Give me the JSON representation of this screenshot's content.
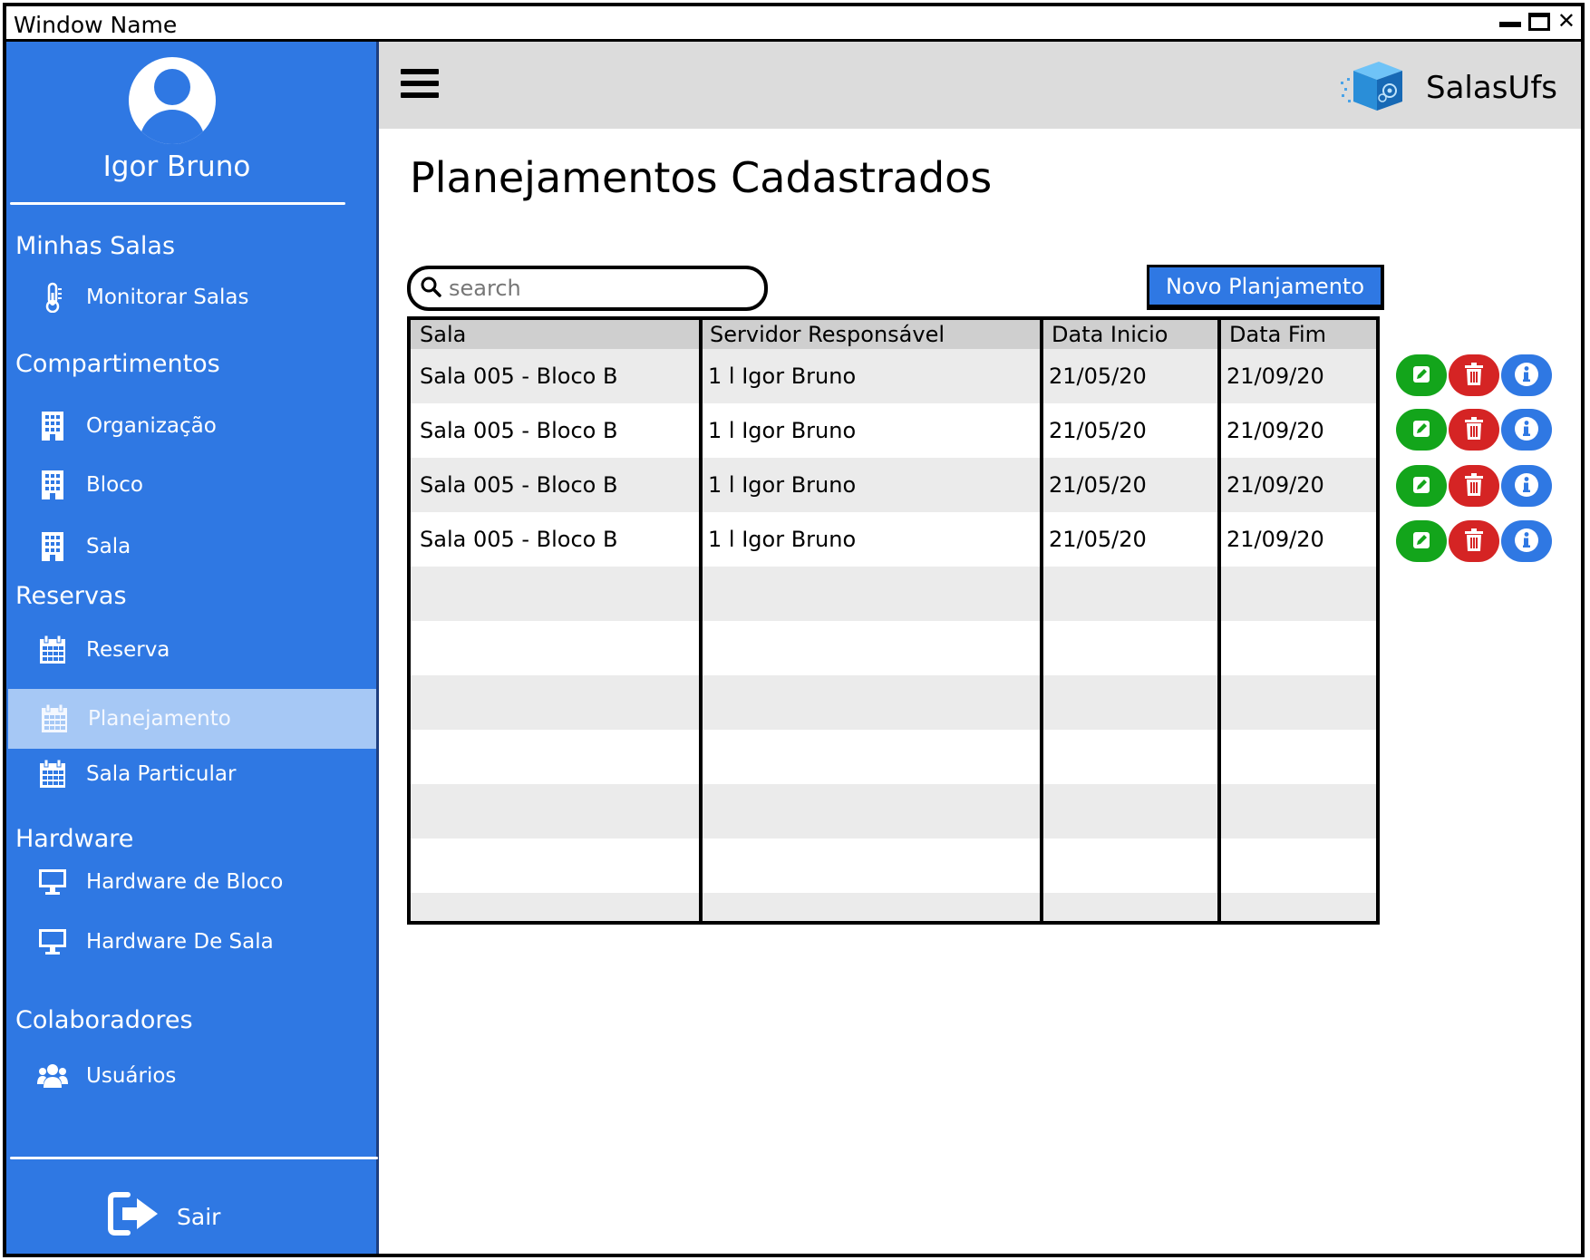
{
  "window": {
    "title": "Window Name"
  },
  "user": {
    "name": "Igor Bruno",
    "avatar_icon": "user-avatar-icon"
  },
  "sidebar": {
    "sections": [
      {
        "label": "Minhas Salas",
        "items": [
          {
            "label": "Monitorar Salas",
            "icon": "thermometer-icon"
          }
        ]
      },
      {
        "label": "Compartimentos",
        "items": [
          {
            "label": "Organização",
            "icon": "building-icon"
          },
          {
            "label": "Bloco",
            "icon": "building-icon"
          },
          {
            "label": "Sala",
            "icon": "building-icon"
          }
        ]
      },
      {
        "label": "Reservas",
        "items": [
          {
            "label": "Reserva",
            "icon": "calendar-icon"
          },
          {
            "label": "Planejamento",
            "icon": "calendar-icon",
            "active": true
          },
          {
            "label": "Sala Particular",
            "icon": "calendar-icon"
          }
        ]
      },
      {
        "label": "Hardware",
        "items": [
          {
            "label": "Hardware de Bloco",
            "icon": "monitor-icon"
          },
          {
            "label": "Hardware De Sala",
            "icon": "monitor-icon"
          }
        ]
      },
      {
        "label": "Colaboradores",
        "items": [
          {
            "label": "Usuários",
            "icon": "users-icon"
          }
        ]
      }
    ],
    "logout_label": "Sair"
  },
  "header": {
    "brand": "SalasUfs",
    "brand_icon": "cube-logo-icon",
    "menu_icon": "hamburger-icon"
  },
  "page": {
    "title": "Planejamentos Cadastrados",
    "search_placeholder": "search",
    "new_button": "Novo Planjamento"
  },
  "table": {
    "columns": [
      "Sala",
      "Servidor Responsável",
      "Data Inicio",
      "Data Fim"
    ],
    "rows": [
      [
        "Sala 005 - Bloco B",
        "1 l Igor Bruno",
        "21/05/20",
        "21/09/20"
      ],
      [
        "Sala 005 - Bloco B",
        "1 l Igor Bruno",
        "21/05/20",
        "21/09/20"
      ],
      [
        "Sala 005 - Bloco B",
        "1 l Igor Bruno",
        "21/05/20",
        "21/09/20"
      ],
      [
        "Sala 005 - Bloco B",
        "1 l Igor Bruno",
        "21/05/20",
        "21/09/20"
      ]
    ],
    "row_actions": [
      "edit-icon",
      "trash-icon",
      "info-icon"
    ]
  },
  "colors": {
    "sidebar": "#2f78e3",
    "active_item": "#a6c8f5",
    "topbar": "#dcdcdc",
    "edit": "#13a51b",
    "delete": "#d52424",
    "info": "#2f78e3",
    "row_alt": "#ebebeb",
    "header_row": "#cfcfcf"
  }
}
